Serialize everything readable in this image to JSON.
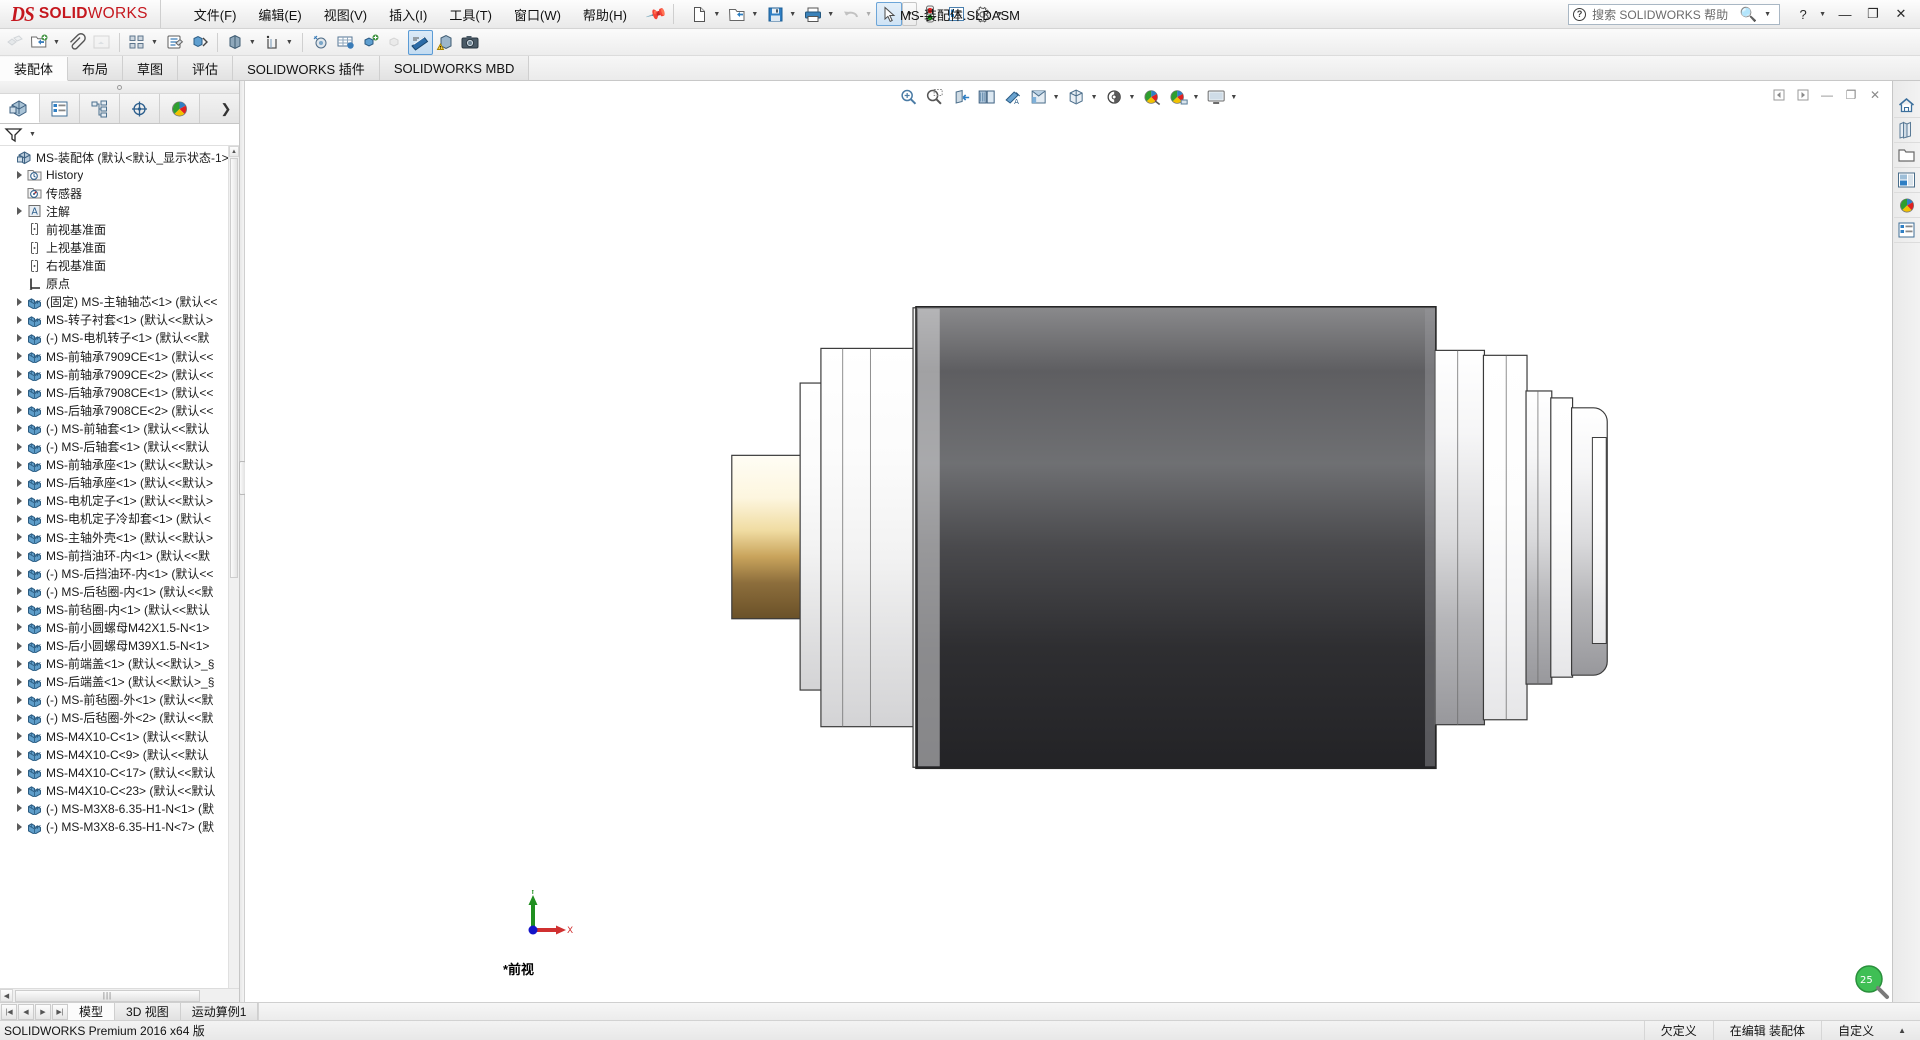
{
  "app": {
    "brand_ds": "DS",
    "brand_bold": "SOLID",
    "brand_light": "WORKS",
    "document_title": "MS-装配体.SLDASM",
    "status_version": "SOLIDWORKS Premium 2016 x64 版"
  },
  "menu": {
    "items": [
      {
        "label": "文件(F)",
        "name": "menu-file"
      },
      {
        "label": "编辑(E)",
        "name": "menu-edit"
      },
      {
        "label": "视图(V)",
        "name": "menu-view"
      },
      {
        "label": "插入(I)",
        "name": "menu-insert"
      },
      {
        "label": "工具(T)",
        "name": "menu-tools"
      },
      {
        "label": "窗口(W)",
        "name": "menu-window"
      },
      {
        "label": "帮助(H)",
        "name": "menu-help"
      }
    ],
    "pin_icon": "pin-icon"
  },
  "quick_access": {
    "buttons": [
      {
        "name": "new-document-button",
        "icon": "new-file-icon",
        "dropdown": true
      },
      {
        "name": "open-document-button",
        "icon": "open-folder-icon",
        "dropdown": true
      },
      {
        "name": "save-button",
        "icon": "floppy-disk-icon",
        "dropdown": true
      },
      {
        "name": "print-button",
        "icon": "printer-icon",
        "dropdown": true
      },
      {
        "name": "undo-button",
        "icon": "undo-arrow-icon",
        "dropdown": true,
        "disabled": true
      },
      {
        "name": "select-button",
        "icon": "cursor-arrow-icon",
        "dropdown": true,
        "active": true
      },
      {
        "name": "rebuild-button",
        "icon": "traffic-light-icon",
        "dropdown": false
      },
      {
        "name": "file-properties-button",
        "icon": "properties-list-icon",
        "dropdown": false
      },
      {
        "name": "options-button",
        "icon": "gear-icon",
        "dropdown": true
      }
    ]
  },
  "search": {
    "placeholder": "搜索 SOLIDWORKS 帮助",
    "help_icon": "question-circle-icon",
    "magnifier_icon": "magnifier-icon"
  },
  "window_controls": {
    "help": "?",
    "minimize": "—",
    "restore": "❐",
    "close": "✕"
  },
  "command_toolbar": {
    "buttons": [
      {
        "name": "edit-component-button",
        "icon": "edit-component-icon",
        "disabled": true
      },
      {
        "name": "insert-components-button",
        "icon": "insert-component-icon",
        "dropdown": true
      },
      {
        "name": "mate-button",
        "icon": "paperclip-mate-icon"
      },
      {
        "name": "component-preview-button",
        "icon": "component-preview-icon",
        "disabled": true
      },
      {
        "name": "linear-component-pattern-button",
        "icon": "linear-pattern-icon",
        "dropdown": true
      },
      {
        "name": "smart-fasteners-button",
        "icon": "smart-fastener-icon"
      },
      {
        "name": "move-component-button",
        "icon": "move-component-icon",
        "dropdown": true
      },
      {
        "name": "show-hidden-components-button",
        "icon": "show-hidden-icon"
      },
      {
        "name": "assembly-features-button",
        "icon": "assembly-feature-icon",
        "dropdown": true
      },
      {
        "name": "reference-geometry-button",
        "icon": "reference-geometry-icon",
        "dropdown": true
      },
      {
        "name": "new-motion-study-button",
        "icon": "motion-study-icon"
      },
      {
        "name": "bill-of-materials-button",
        "icon": "bom-table-icon"
      },
      {
        "name": "exploded-view-button",
        "icon": "exploded-view-icon"
      },
      {
        "name": "explode-line-sketch-button",
        "icon": "explode-line-icon",
        "disabled": true
      },
      {
        "name": "interference-detection-button",
        "icon": "interference-detect-icon",
        "active": true
      },
      {
        "name": "measure-button",
        "icon": "measure-warning-icon"
      },
      {
        "name": "screen-capture-button",
        "icon": "camera-icon"
      }
    ]
  },
  "ribbon_tabs": [
    {
      "label": "装配体",
      "name": "tab-assembly",
      "active": true
    },
    {
      "label": "布局",
      "name": "tab-layout",
      "active": false
    },
    {
      "label": "草图",
      "name": "tab-sketch",
      "active": false
    },
    {
      "label": "评估",
      "name": "tab-evaluate",
      "active": false
    },
    {
      "label": "SOLIDWORKS 插件",
      "name": "tab-solidworks-addins",
      "active": false
    },
    {
      "label": "SOLIDWORKS MBD",
      "name": "tab-solidworks-mbd",
      "active": false
    }
  ],
  "feature_manager": {
    "tabs": [
      {
        "name": "tab-feature-manager-tree",
        "icon": "feature-tree-icon",
        "active": true
      },
      {
        "name": "tab-property-manager",
        "icon": "property-manager-icon",
        "active": false
      },
      {
        "name": "tab-configuration-manager",
        "icon": "configuration-manager-icon",
        "active": false
      },
      {
        "name": "tab-dimxpert-manager",
        "icon": "dimxpert-icon",
        "active": false
      },
      {
        "name": "tab-display-manager",
        "icon": "display-manager-sphere-icon",
        "active": false
      }
    ],
    "expand_arrow": "chevron-right-icon",
    "filter_icon": "filter-funnel-icon",
    "tree": [
      {
        "label": "MS-装配体  (默认<默认_显示状态-1>",
        "icon": "assembly-icon",
        "arrow": false,
        "indent": 0,
        "name": "tree-root-assembly"
      },
      {
        "label": "History",
        "icon": "history-folder-icon",
        "arrow": true,
        "indent": 1,
        "name": "tree-item-history"
      },
      {
        "label": "传感器",
        "icon": "sensor-icon",
        "arrow": false,
        "indent": 1,
        "name": "tree-item-sensors"
      },
      {
        "label": "注解",
        "icon": "annotations-icon",
        "arrow": true,
        "indent": 1,
        "name": "tree-item-annotations"
      },
      {
        "label": "前视基准面",
        "icon": "plane-icon",
        "arrow": false,
        "indent": 1,
        "name": "tree-item-front-plane"
      },
      {
        "label": "上视基准面",
        "icon": "plane-icon",
        "arrow": false,
        "indent": 1,
        "name": "tree-item-top-plane"
      },
      {
        "label": "右视基准面",
        "icon": "plane-icon",
        "arrow": false,
        "indent": 1,
        "name": "tree-item-right-plane"
      },
      {
        "label": "原点",
        "icon": "origin-icon",
        "arrow": false,
        "indent": 1,
        "name": "tree-item-origin"
      },
      {
        "label": "(固定) MS-主轴轴芯<1>  (默认<<",
        "icon": "component-icon",
        "arrow": true,
        "indent": 1,
        "name": "tree-item-component"
      },
      {
        "label": "MS-转子衬套<1>  (默认<<默认>",
        "icon": "component-icon",
        "arrow": true,
        "indent": 1,
        "name": "tree-item-component"
      },
      {
        "label": "(-) MS-电机转子<1>  (默认<<默",
        "icon": "component-icon",
        "arrow": true,
        "indent": 1,
        "name": "tree-item-component"
      },
      {
        "label": "MS-前轴承7909CE<1>  (默认<<",
        "icon": "component-icon",
        "arrow": true,
        "indent": 1,
        "name": "tree-item-component"
      },
      {
        "label": "MS-前轴承7909CE<2>  (默认<<",
        "icon": "component-icon",
        "arrow": true,
        "indent": 1,
        "name": "tree-item-component"
      },
      {
        "label": "MS-后轴承7908CE<1>  (默认<<",
        "icon": "component-icon",
        "arrow": true,
        "indent": 1,
        "name": "tree-item-component"
      },
      {
        "label": "MS-后轴承7908CE<2>  (默认<<",
        "icon": "component-icon",
        "arrow": true,
        "indent": 1,
        "name": "tree-item-component"
      },
      {
        "label": "(-) MS-前轴套<1>  (默认<<默认",
        "icon": "component-icon",
        "arrow": true,
        "indent": 1,
        "name": "tree-item-component"
      },
      {
        "label": "(-) MS-后轴套<1>  (默认<<默认",
        "icon": "component-icon",
        "arrow": true,
        "indent": 1,
        "name": "tree-item-component"
      },
      {
        "label": "MS-前轴承座<1>  (默认<<默认>",
        "icon": "component-icon",
        "arrow": true,
        "indent": 1,
        "name": "tree-item-component"
      },
      {
        "label": "MS-后轴承座<1>  (默认<<默认>",
        "icon": "component-icon",
        "arrow": true,
        "indent": 1,
        "name": "tree-item-component"
      },
      {
        "label": "MS-电机定子<1>  (默认<<默认>",
        "icon": "component-icon",
        "arrow": true,
        "indent": 1,
        "name": "tree-item-component"
      },
      {
        "label": "MS-电机定子冷却套<1>  (默认<",
        "icon": "component-icon",
        "arrow": true,
        "indent": 1,
        "name": "tree-item-component"
      },
      {
        "label": "MS-主轴外壳<1>  (默认<<默认>",
        "icon": "component-icon",
        "arrow": true,
        "indent": 1,
        "name": "tree-item-component"
      },
      {
        "label": "MS-前挡油环-内<1>  (默认<<默",
        "icon": "component-icon",
        "arrow": true,
        "indent": 1,
        "name": "tree-item-component"
      },
      {
        "label": "(-) MS-后挡油环-内<1>  (默认<<",
        "icon": "component-icon",
        "arrow": true,
        "indent": 1,
        "name": "tree-item-component"
      },
      {
        "label": "(-) MS-后毡圈-内<1>  (默认<<默",
        "icon": "component-icon",
        "arrow": true,
        "indent": 1,
        "name": "tree-item-component"
      },
      {
        "label": "MS-前毡圈-内<1>  (默认<<默认",
        "icon": "component-icon",
        "arrow": true,
        "indent": 1,
        "name": "tree-item-component"
      },
      {
        "label": "MS-前小圆螺母M42X1.5-N<1>",
        "icon": "component-icon",
        "arrow": true,
        "indent": 1,
        "name": "tree-item-component"
      },
      {
        "label": "MS-后小圆螺母M39X1.5-N<1>",
        "icon": "component-icon",
        "arrow": true,
        "indent": 1,
        "name": "tree-item-component"
      },
      {
        "label": "MS-前端盖<1>  (默认<<默认>_§",
        "icon": "component-icon",
        "arrow": true,
        "indent": 1,
        "name": "tree-item-component"
      },
      {
        "label": "MS-后端盖<1>  (默认<<默认>_§",
        "icon": "component-icon",
        "arrow": true,
        "indent": 1,
        "name": "tree-item-component"
      },
      {
        "label": "(-) MS-前毡圈-外<1>  (默认<<默",
        "icon": "component-icon",
        "arrow": true,
        "indent": 1,
        "name": "tree-item-component"
      },
      {
        "label": "(-) MS-后毡圈-外<2>  (默认<<默",
        "icon": "component-icon",
        "arrow": true,
        "indent": 1,
        "name": "tree-item-component"
      },
      {
        "label": "MS-M4X10-C<1>  (默认<<默认",
        "icon": "component-icon",
        "arrow": true,
        "indent": 1,
        "name": "tree-item-component"
      },
      {
        "label": "MS-M4X10-C<9>  (默认<<默认",
        "icon": "component-icon",
        "arrow": true,
        "indent": 1,
        "name": "tree-item-component"
      },
      {
        "label": "MS-M4X10-C<17>  (默认<<默认",
        "icon": "component-icon",
        "arrow": true,
        "indent": 1,
        "name": "tree-item-component"
      },
      {
        "label": "MS-M4X10-C<23>  (默认<<默认",
        "icon": "component-icon",
        "arrow": true,
        "indent": 1,
        "name": "tree-item-component"
      },
      {
        "label": "(-) MS-M3X8-6.35-H1-N<1>  (默",
        "icon": "component-icon",
        "arrow": true,
        "indent": 1,
        "name": "tree-item-component"
      },
      {
        "label": "(-) MS-M3X8-6.35-H1-N<7>  (默",
        "icon": "component-icon",
        "arrow": true,
        "indent": 1,
        "name": "tree-item-component"
      }
    ]
  },
  "view_toolbar": {
    "buttons": [
      {
        "name": "zoom-to-fit-button",
        "icon": "zoom-to-fit-icon"
      },
      {
        "name": "zoom-to-area-button",
        "icon": "zoom-to-area-icon"
      },
      {
        "name": "section-view-button",
        "icon": "section-view-icon"
      },
      {
        "name": "view-orientation-button",
        "icon": "view-orientation-icon"
      },
      {
        "name": "display-style-button",
        "icon": "display-style-icon"
      },
      {
        "name": "hide-show-items-button",
        "icon": "hide-show-items-icon",
        "dropdown": true
      },
      {
        "name": "apply-scene-button",
        "icon": "apply-scene-cube-icon",
        "dropdown": true
      },
      {
        "name": "view-settings-button",
        "icon": "view-settings-icon",
        "dropdown": true
      },
      {
        "name": "edit-appearance-button",
        "icon": "appearance-sphere-icon"
      },
      {
        "name": "apply-scene-sphere-button",
        "icon": "scene-sphere-icon",
        "dropdown": true
      },
      {
        "name": "viewport-button",
        "icon": "viewport-monitor-icon",
        "dropdown": true
      }
    ]
  },
  "graphics_window_controls": {
    "prev": "◀|",
    "next": "|▶",
    "minimize": "—",
    "restore": "❐",
    "close": "✕"
  },
  "graphics": {
    "view_label": "*前视",
    "triad": {
      "x_label": "X",
      "y_label": "Y",
      "x_color": "#cc0000",
      "y_color": "#00a000",
      "origin_color": "#0000cc"
    },
    "magnifier_zoom": "25"
  },
  "task_pane": {
    "buttons": [
      {
        "name": "task-pane-resources-button",
        "icon": "home-icon"
      },
      {
        "name": "task-pane-design-library-button",
        "icon": "design-library-icon"
      },
      {
        "name": "task-pane-file-explorer-button",
        "icon": "folder-icon"
      },
      {
        "name": "task-pane-view-palette-button",
        "icon": "view-palette-icon"
      },
      {
        "name": "task-pane-appearances-button",
        "icon": "appearance-sphere-icon"
      },
      {
        "name": "task-pane-custom-properties-button",
        "icon": "custom-properties-icon"
      }
    ]
  },
  "bottom_tabs": {
    "nav_buttons": [
      "first-tab-icon",
      "prev-tab-icon",
      "next-tab-icon",
      "last-tab-icon"
    ],
    "tabs": [
      {
        "label": "模型",
        "name": "bottom-tab-model",
        "active": true
      },
      {
        "label": "3D 视图",
        "name": "bottom-tab-3d-views",
        "active": false
      },
      {
        "label": "运动算例1",
        "name": "bottom-tab-motion-study-1",
        "active": false
      }
    ]
  },
  "status_bar": {
    "version": "SOLIDWORKS Premium 2016 x64 版",
    "underdefined": "欠定义",
    "editing": "在编辑 装配体",
    "custom": "自定义",
    "expand_icon": "chevron-up-icon"
  },
  "colors": {
    "brand_red": "#c5171e",
    "accent_blue": "#2a6fb5",
    "panel_bg": "#f0f0f0",
    "graphics_bg": "#ffffff"
  }
}
